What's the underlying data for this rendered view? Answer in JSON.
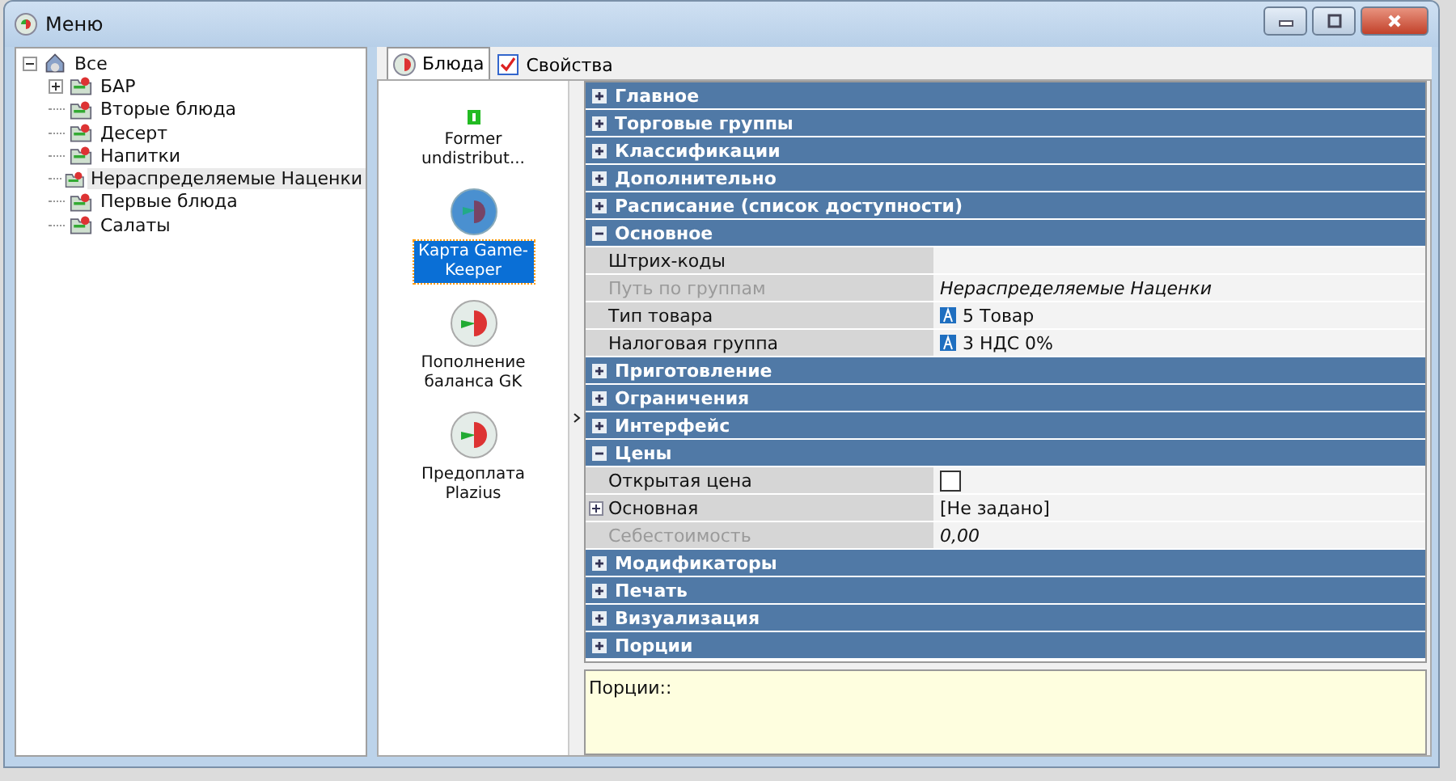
{
  "window": {
    "title": "Меню"
  },
  "tree": {
    "label": "Все",
    "expanded": true,
    "children": [
      {
        "label": "БАР",
        "expanded": false,
        "selected": false
      },
      {
        "label": "Вторые блюда",
        "selected": false
      },
      {
        "label": "Десерт",
        "selected": false
      },
      {
        "label": "Напитки",
        "selected": false
      },
      {
        "label": "Нераспределяемые Наценки",
        "selected": true
      },
      {
        "label": "Первые блюда",
        "selected": false
      },
      {
        "label": "Салаты",
        "selected": false
      }
    ]
  },
  "tabs": [
    {
      "label": "Блюда",
      "selected": true,
      "kind": "dish"
    },
    {
      "label": "Свойства",
      "selected": false,
      "kind": "props"
    }
  ],
  "items": [
    {
      "kind": "marker",
      "label": "Former undistribut...",
      "selected": false
    },
    {
      "kind": "card",
      "label": "Карта Game-Keeper",
      "selected": true
    },
    {
      "kind": "plate",
      "label": "Пополнение баланса GK",
      "selected": false
    },
    {
      "kind": "plate",
      "label": "Предоплата Plazius",
      "selected": false
    }
  ],
  "sections": [
    {
      "title": "Главное",
      "expanded": false
    },
    {
      "title": "Торговые группы",
      "expanded": false
    },
    {
      "title": "Классификации",
      "expanded": false
    },
    {
      "title": "Дополнительно",
      "expanded": false
    },
    {
      "title": "Расписание (список доступности)",
      "expanded": false
    },
    {
      "title": "Основное",
      "expanded": true,
      "rows": [
        {
          "name": "Штрих-коды",
          "kind": "text",
          "disabled": false
        },
        {
          "name": "Путь по группам",
          "kind": "italic",
          "value": "Нераспределяемые Наценки",
          "disabled": true
        },
        {
          "name": "Тип товара",
          "kind": "ref",
          "value": "5 Товар",
          "disabled": false
        },
        {
          "name": "Налоговая группа",
          "kind": "ref",
          "value": "3 НДС 0%",
          "disabled": false
        }
      ]
    },
    {
      "title": "Приготовление",
      "expanded": false
    },
    {
      "title": "Ограничения",
      "expanded": false
    },
    {
      "title": "Интерфейс",
      "expanded": false
    },
    {
      "title": "Цены",
      "expanded": true,
      "rows": [
        {
          "name": "Открытая цена",
          "kind": "checkbox",
          "checked": false,
          "disabled": false
        },
        {
          "name": "Основная",
          "kind": "group",
          "value": "[Не задано]",
          "disabled": false
        },
        {
          "name": "Себестоимость",
          "kind": "italic",
          "value": "0,00",
          "disabled": true
        }
      ]
    },
    {
      "title": "Модификаторы",
      "expanded": false
    },
    {
      "title": "Печать",
      "expanded": false
    },
    {
      "title": "Визуализация",
      "expanded": false
    },
    {
      "title": "Порции",
      "expanded": false
    }
  ],
  "description": "Порции::"
}
